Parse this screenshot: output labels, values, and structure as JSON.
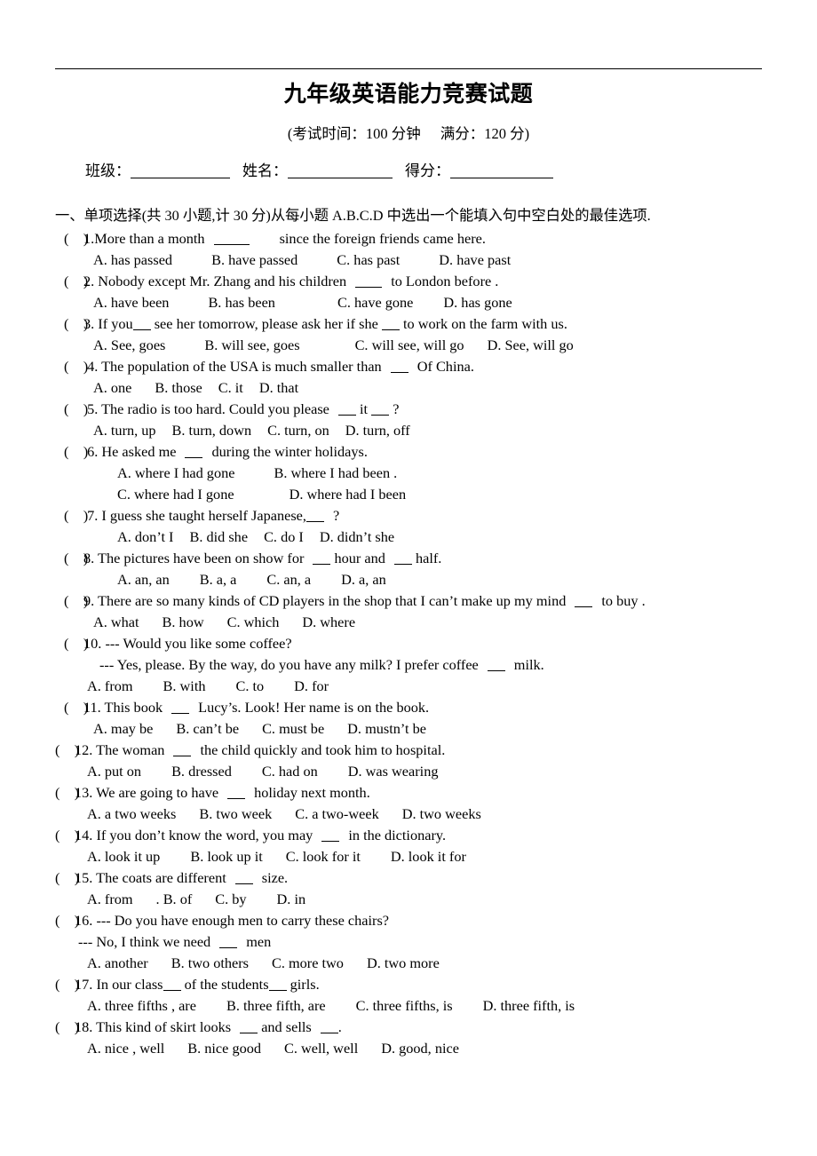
{
  "document": {
    "title": "九年级英语能力竞赛试题",
    "exam_info_time": "(考试时间：100 分钟",
    "exam_info_score": "满分：120 分)",
    "field_class_label": "班级：",
    "field_name_label": "姓名：",
    "field_score_label": "得分：",
    "section_heading": "一、单项选择(共 30 小题,计 30 分)从每小题 A.B.C.D 中选出一个能填入句中空白处的最佳选项."
  },
  "questions": [
    {
      "number": "1.",
      "stem_before": "More than a month",
      "stem_after": "since the foreign friends came here.",
      "options": [
        "A. has passed",
        "B. have passed",
        "C. has past",
        "D. have past"
      ]
    },
    {
      "number": "2.",
      "stem_before": "Nobody except Mr. Zhang and his children",
      "stem_after": "to London before .",
      "options": [
        "A. have been",
        "B. has been",
        "C. have gone",
        "D. has gone"
      ]
    },
    {
      "number": "3.",
      "stem_before": "If you",
      "stem_mid": "see her tomorrow, please ask her if she",
      "stem_after": "to work on the farm with us.",
      "options": [
        "A. See, goes",
        "B. will see, goes",
        "C. will see, will go",
        "D. See, will go"
      ]
    },
    {
      "number": "4.",
      "stem_before": "The population of the USA is much smaller than",
      "stem_after": "Of China.",
      "options": [
        "A. one",
        "B. those",
        "C. it",
        "D. that"
      ]
    },
    {
      "number": "5.",
      "stem_before": "The radio is too hard. Could you please",
      "stem_mid": "it",
      "stem_after": "?",
      "options": [
        "A.  turn, up",
        "B. turn, down",
        "C. turn, on",
        "D. turn, off"
      ]
    },
    {
      "number": "6.",
      "stem_before": "He asked me",
      "stem_after": "during the winter holidays.",
      "options": [
        "A.  where I had gone",
        "B. where I had been .",
        "C. where had I gone",
        "D. where had I been"
      ]
    },
    {
      "number": "7.",
      "stem_before": "I guess she taught herself Japanese,",
      "stem_after": "?",
      "options": [
        "A.  don’t I",
        "B. did she",
        "C. do I",
        "D. didn’t she"
      ]
    },
    {
      "number": "8.",
      "stem_before": "The pictures have been on show for",
      "stem_mid": "hour and",
      "stem_after": "half.",
      "options": [
        "A. an, an",
        "B. a, a",
        "C. an, a",
        "D. a, an"
      ]
    },
    {
      "number": "9.",
      "stem_before": "There are so many kinds of CD players in the shop that I can’t make up my mind",
      "stem_after": "to buy .",
      "options": [
        "A. what",
        "B. how",
        "C. which",
        "D. where"
      ]
    },
    {
      "number": "10.",
      "stem_before": "--- Would you like some coffee?",
      "sub_line_before": "--- Yes, please. By the way, do you have any milk? I prefer coffee",
      "sub_line_after": "milk.",
      "options": [
        "A. from",
        "B. with",
        "C. to",
        "D. for"
      ]
    },
    {
      "number": "11.",
      "stem_before": "This book",
      "stem_after": "Lucy’s. Look! Her name is on the book.",
      "options": [
        "A.  may be",
        "B. can’t be",
        "C. must be",
        "D. mustn’t be"
      ]
    },
    {
      "number": "12.",
      "stem_before": "The woman",
      "stem_after": "the child quickly and took him to hospital.",
      "options": [
        "A. put on",
        "B. dressed",
        "C. had on",
        "D. was wearing"
      ]
    },
    {
      "number": "13.",
      "stem_before": "We are going to have",
      "stem_after": "holiday next month.",
      "options": [
        "A.  a two weeks",
        "B. two week",
        "C. a two-week",
        "D. two weeks"
      ]
    },
    {
      "number": "14.",
      "stem_before": "If you don’t know the word, you may",
      "stem_after": "in the dictionary.",
      "options": [
        "A. look it up",
        "B. look up it",
        "C. look for it",
        "D. look it for"
      ]
    },
    {
      "number": "15.",
      "stem_before": "The coats are different",
      "stem_after": "size.",
      "options": [
        "A. from",
        ". B. of",
        "C. by",
        "D. in"
      ]
    },
    {
      "number": "16.",
      "stem_before": "--- Do you have enough men to carry these chairs?",
      "sub_line_before": "--- No, I think we need",
      "sub_line_after": "men",
      "options": [
        "A.  another",
        "B. two others",
        "C. more two",
        "D. two more"
      ]
    },
    {
      "number": "17.",
      "stem_before": "In our class",
      "stem_mid": "of the students",
      "stem_after": "girls.",
      "options": [
        "A.  three fifths , are",
        "B. three fifth, are",
        "C. three fifths, is",
        "D. three fifth, is"
      ]
    },
    {
      "number": "18.",
      "stem_before": "This kind of skirt looks",
      "stem_mid": "and sells",
      "stem_after": ".",
      "options": [
        "A.  nice , well",
        "B. nice good",
        "C. well, well",
        "D. good, nice"
      ]
    }
  ]
}
